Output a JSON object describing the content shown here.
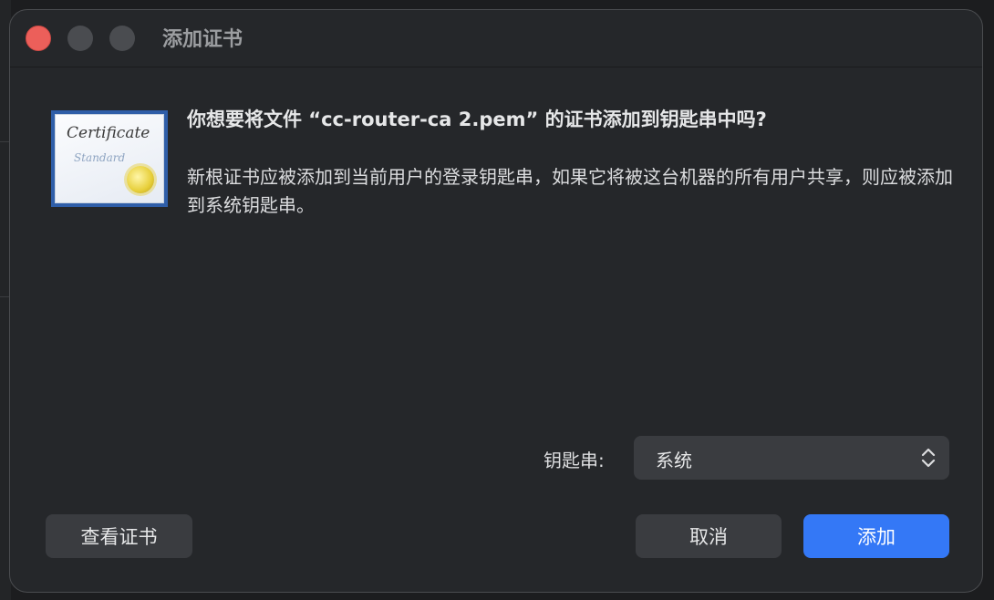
{
  "window": {
    "title": "添加证书"
  },
  "certificate_icon": {
    "line1": "Certificate",
    "line2": "Standard"
  },
  "dialog": {
    "heading": "你想要将文件 “cc-router-ca 2.pem” 的证书添加到钥匙串中吗?",
    "body": "新根证书应被添加到当前用户的登录钥匙串，如果它将被这台机器的所有用户共享，则应被添加到系统钥匙串。"
  },
  "keychain": {
    "label": "钥匙串:",
    "selected": "系统"
  },
  "buttons": {
    "view": "查看证书",
    "cancel": "取消",
    "add": "添加"
  },
  "colors": {
    "accent": "#3478f6",
    "close": "#ec5f5a",
    "background": "#25272a"
  }
}
